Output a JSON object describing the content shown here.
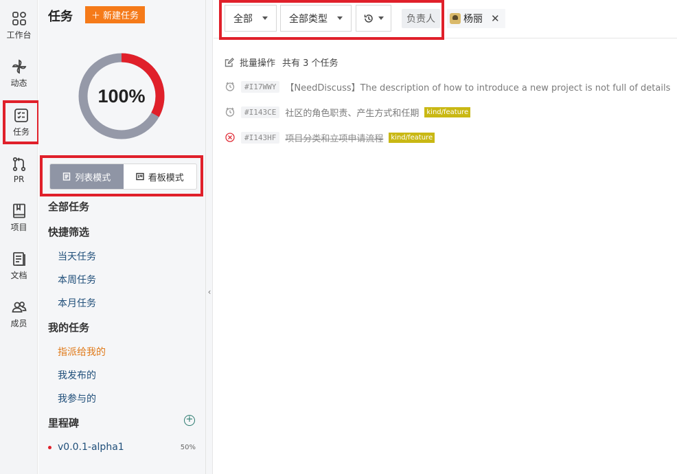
{
  "rail": {
    "items": [
      {
        "label": "工作台",
        "icon": "workspace-icon"
      },
      {
        "label": "动态",
        "icon": "pinwheel-icon"
      },
      {
        "label": "任务",
        "icon": "task-icon",
        "active": true
      },
      {
        "label": "PR",
        "icon": "pull-request-icon"
      },
      {
        "label": "项目",
        "icon": "book-icon"
      },
      {
        "label": "文档",
        "icon": "document-icon"
      },
      {
        "label": "成员",
        "icon": "members-icon"
      }
    ]
  },
  "sidebar": {
    "title": "任务",
    "new_task_label": "新建任务",
    "progress": {
      "percent_text": "100%",
      "done_fraction": 0.33,
      "done_color": "#e0202a",
      "rest_color": "#9599a8"
    },
    "modes": {
      "list_label": "列表模式",
      "board_label": "看板模式"
    },
    "all_tasks": "全部任务",
    "quick_filter": {
      "heading": "快捷筛选",
      "items": [
        "当天任务",
        "本周任务",
        "本月任务"
      ]
    },
    "my_tasks": {
      "heading": "我的任务",
      "items": [
        "指派给我的",
        "我发布的",
        "我参与的"
      ]
    },
    "milestones": {
      "heading": "里程碑",
      "items": [
        {
          "name": "v0.0.1-alpha1",
          "percent": "50%"
        }
      ]
    }
  },
  "filters": {
    "status": "全部",
    "type": "全部类型",
    "assignee_label": "负责人",
    "assignee_value": "杨丽"
  },
  "batch": {
    "action_label": "批量操作",
    "count_text": "共有 3 个任务"
  },
  "tasks": [
    {
      "number": "#I17WWY",
      "title": "【NeedDiscuss】The description of how to introduce a new project is not full of details",
      "tag": "",
      "status": "open"
    },
    {
      "number": "#I143CE",
      "title": "社区的角色职责、产生方式和任期",
      "tag": "kind/feature",
      "status": "open"
    },
    {
      "number": "#I143HF",
      "title": "项目分类和立项申请流程",
      "tag": "kind/feature",
      "status": "rejected"
    }
  ],
  "colors": {
    "accent_orange": "#f57a19",
    "highlight_red": "#e0202a",
    "tag_yellow": "#c9b814"
  }
}
